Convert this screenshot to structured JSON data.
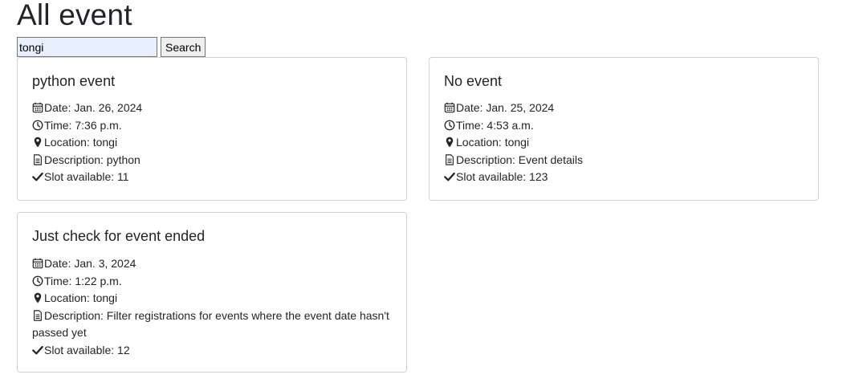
{
  "page": {
    "title": "All event"
  },
  "search": {
    "value": "tongi",
    "button_label": "Search"
  },
  "events": [
    {
      "title": "python event",
      "date": "Date: Jan. 26, 2024",
      "time": "Time: 7:36 p.m.",
      "location": "Location: tongi",
      "description": "Description: python",
      "slots": "Slot available: 11"
    },
    {
      "title": "No event",
      "date": "Date: Jan. 25, 2024",
      "time": "Time: 4:53 a.m.",
      "location": "Location: tongi",
      "description": "Description: Event details",
      "slots": "Slot available: 123"
    },
    {
      "title": "Just check for event ended",
      "date": "Date: Jan. 3, 2024",
      "time": "Time: 1:22 p.m.",
      "location": "Location: tongi",
      "description": "Description: Filter registrations for events where the event date hasn't passed yet",
      "slots": "Slot available: 12"
    }
  ],
  "icons": {
    "date": "calendar-icon",
    "time": "clock-icon",
    "location": "map-pin-icon",
    "description": "document-icon",
    "slots": "check-icon"
  },
  "colors": {
    "search_input_bg": "#e8f0fe",
    "card_border": "#dee2e6",
    "text": "#212529"
  }
}
